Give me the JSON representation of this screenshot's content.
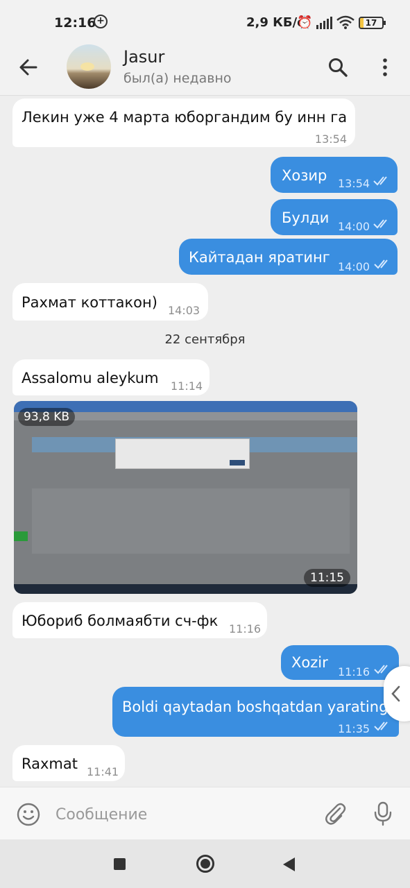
{
  "status_bar": {
    "time": "12:16",
    "notification_glyph": "+",
    "speed": "2,9 КБ/с",
    "battery": "17",
    "battery_level": 0.17,
    "icons": [
      "alarm-icon",
      "signal-icon",
      "wifi-icon",
      "battery-icon"
    ]
  },
  "header": {
    "contact_name": "Jasur",
    "contact_status": "был(а) недавно",
    "icons": [
      "back-arrow-icon",
      "search-icon",
      "more-vert-icon"
    ]
  },
  "messages": [
    {
      "dir": "in",
      "text": "Лекин уже 4 марта юборгандим бу инн га",
      "time": "13:54"
    },
    {
      "dir": "out",
      "text": "Хозир",
      "time": "13:54",
      "read": true
    },
    {
      "dir": "out",
      "text": "Булди",
      "time": "14:00",
      "read": true
    },
    {
      "dir": "out",
      "text": "Кайтадан яратинг",
      "time": "14:00",
      "read": true
    },
    {
      "dir": "in",
      "text": "Рахмат коттакон)",
      "time": "14:03"
    },
    {
      "dir": "in",
      "text": "Assalomu aleykum",
      "time": "11:14"
    },
    {
      "dir": "in",
      "text": "Юбориб болмаябти сч-фк",
      "time": "11:16"
    },
    {
      "dir": "out",
      "text": "Xozir",
      "time": "11:16",
      "read": true
    },
    {
      "dir": "out",
      "text": "Boldi qaytadan boshqatdan yarating",
      "time": "11:35",
      "read": true
    },
    {
      "dir": "in",
      "text": "Raxmat",
      "time": "11:41"
    }
  ],
  "date_separator": "22 сентября",
  "photo": {
    "size": "93,8 KB",
    "time": "11:15"
  },
  "input": {
    "placeholder": "Сообщение"
  },
  "colors": {
    "outgoing_bubble": "#3a8ee0",
    "incoming_bubble": "#ffffff",
    "background": "#eeeeee"
  }
}
